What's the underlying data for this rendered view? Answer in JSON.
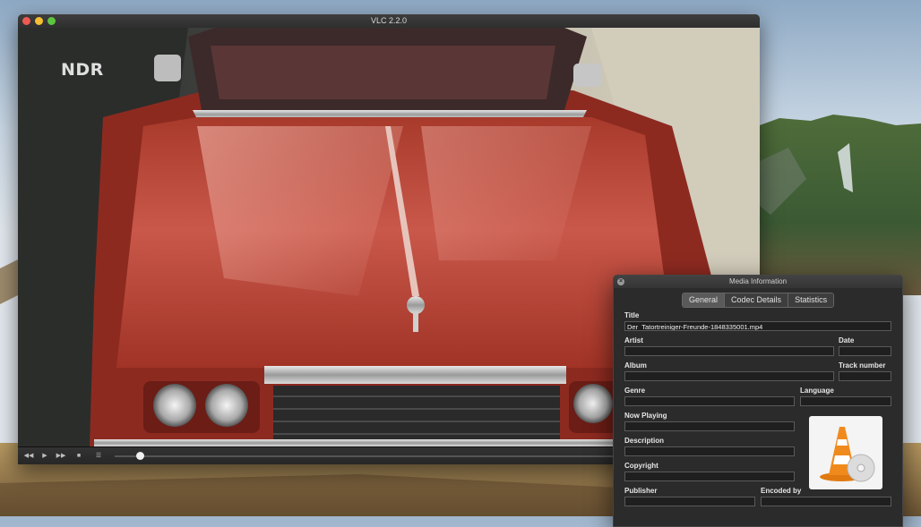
{
  "window": {
    "title": "VLC 2.2.0"
  },
  "video": {
    "channel_logo": "NDR"
  },
  "controls": {
    "rewind_icon": "rewind-icon",
    "play_icon": "play-icon",
    "forward_icon": "fast-forward-icon",
    "stop_icon": "stop-icon",
    "playlist_icon": "playlist-icon",
    "seek_progress": 0.05
  },
  "media_info": {
    "title": "Media Information",
    "tabs": [
      {
        "label": "General",
        "active": true
      },
      {
        "label": "Codec Details",
        "active": false
      },
      {
        "label": "Statistics",
        "active": false
      }
    ],
    "fields": {
      "title_label": "Title",
      "title_value": "Der_Tatortreiniger-Freunde-1848335001.mp4",
      "artist_label": "Artist",
      "artist_value": "",
      "date_label": "Date",
      "date_value": "",
      "album_label": "Album",
      "album_value": "",
      "track_label": "Track number",
      "track_value": "",
      "genre_label": "Genre",
      "genre_value": "",
      "language_label": "Language",
      "language_value": "",
      "nowplaying_label": "Now Playing",
      "nowplaying_value": "",
      "description_label": "Description",
      "description_value": "",
      "copyright_label": "Copyright",
      "copyright_value": "",
      "publisher_label": "Publisher",
      "publisher_value": "",
      "encodedby_label": "Encoded by",
      "encodedby_value": ""
    },
    "artwork_icon": "vlc-cone-icon"
  },
  "colors": {
    "accent_orange": "#f08a1c",
    "car_red": "#b8382b"
  }
}
